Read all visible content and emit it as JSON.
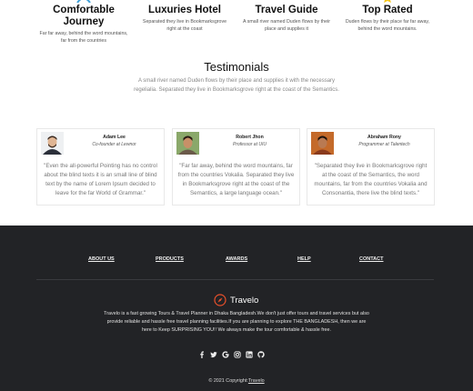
{
  "features": [
    {
      "title": "Comfortable Journey",
      "desc_line1": "Far far away, behind the word mountains,",
      "desc_line2": "far from the countries"
    },
    {
      "title": "Luxuries Hotel",
      "desc_line1": "Separated they live in Bookmarksgrove",
      "desc_line2": "right at the coast"
    },
    {
      "title": "Travel Guide",
      "desc_line1": "A small river named Duden flows by their",
      "desc_line2": "place and supplies it"
    },
    {
      "title": "Top Rated",
      "desc_line1": "Duden flows by their place far far away,",
      "desc_line2": "behind the word mountains."
    }
  ],
  "testimonials": {
    "title": "Testimonials",
    "subtitle": "A small river named Duden flows by their place and supplies it with the necessary regelialia. Separated they live in Bookmarksgrove right at the coast of the Semantics.",
    "cards": [
      {
        "name": "Adam Lee",
        "role": "Co-founder at Lewnor",
        "quote": "\"Even the all-powerful Pointing has no control about the blind texts it is an small line of blind text by the name of Lorem Ipsum decided to leave for the far World of Grammar.\""
      },
      {
        "name": "Robert Jhon",
        "role": "Professor at UIU",
        "quote": "\"Far far away, behind the word mountains, far from the countries Vokalia. Separated they live in Bookmarksgrove right at the coast of the Semantics, a large language ocean.\""
      },
      {
        "name": "Abraham Rony",
        "role": "Programmer at Talentech",
        "quote": "\"Separated they live in Bookmarksgrove right at the coast of the Semantics, the word mountains, far from the countries Vokalia and Consonantia, there live the blind texts.\""
      }
    ]
  },
  "footer": {
    "nav": [
      "ABOUT US",
      "PRODUCTS",
      "AWARDS",
      "HELP",
      "CONTACT"
    ],
    "brand": "Travelo",
    "description": "Travelo is a fast growing Tours & Travel Planner in Dhaka Bangladesh.We don't just offer tours and travel services but also provide reliable and hassle free travel planning facilities.If you are planning to explore THE BANGLADESH, then we are here to Keep SURPRISING YOU!! We always make the tour comfortable & hassle free.",
    "social_icons": [
      "facebook-icon",
      "twitter-icon",
      "google-icon",
      "instagram-icon",
      "linkedin-icon",
      "github-icon"
    ],
    "copyright_prefix": "© 2021 Copyright:",
    "copyright_link": "Travelo"
  },
  "colors": {
    "footer_bg": "#222326",
    "brand_accent": "#e8502b"
  }
}
